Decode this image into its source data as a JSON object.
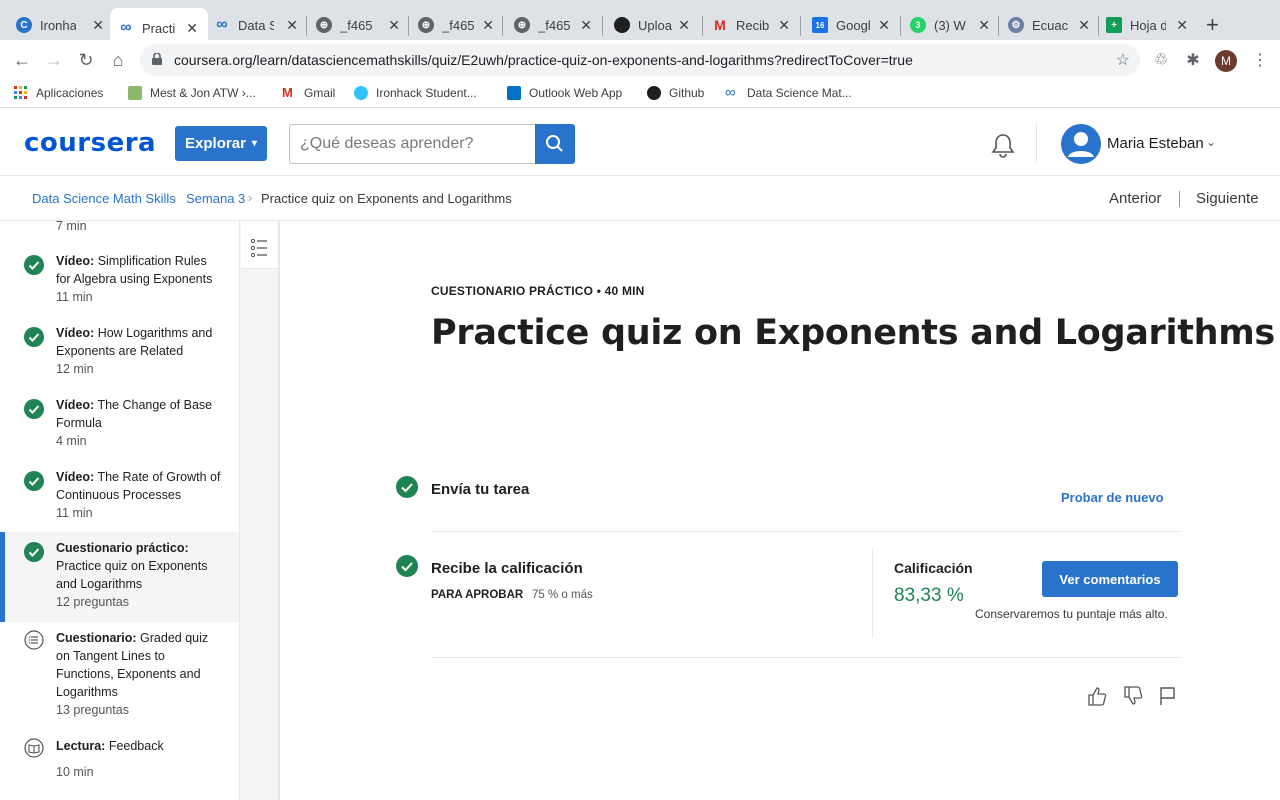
{
  "browser": {
    "tabs": [
      {
        "title": "Ironha",
        "color": "#2a73cc",
        "glyph": "C"
      },
      {
        "title": "Practi",
        "color": "#2a73cc",
        "glyph": "∞",
        "active": true
      },
      {
        "title": "Data S",
        "color": "#2a73cc",
        "glyph": "∞"
      },
      {
        "title": "_f465",
        "color": "#5f6368",
        "glyph": "⊕"
      },
      {
        "title": "_f465",
        "color": "#5f6368",
        "glyph": "⊕"
      },
      {
        "title": "_f465",
        "color": "#5f6368",
        "glyph": "⊕"
      },
      {
        "title": "Uploa",
        "color": "#1f1f1f",
        "glyph": "●"
      },
      {
        "title": "Recib",
        "color": "#d93025",
        "glyph": "M"
      },
      {
        "title": "Googl",
        "color": "#1a73e8",
        "glyph": "16"
      },
      {
        "title": "(3) W",
        "color": "#25d366",
        "glyph": "3"
      },
      {
        "title": "Ecuac",
        "color": "#6a7fa3",
        "glyph": "⚙"
      },
      {
        "title": "Hoja d",
        "color": "#0f9d58",
        "glyph": "+"
      }
    ],
    "url": "coursera.org/learn/datasciencemathskills/quiz/E2uwh/practice-quiz-on-exponents-and-logarithms?redirectToCover=true",
    "profile_initial": "M",
    "bookmarks": [
      {
        "label": "Aplicaciones",
        "icon": "apps-grid-icon"
      },
      {
        "label": "Mest & Jon ATW ›...",
        "icon": "map-icon"
      },
      {
        "label": "Gmail",
        "icon": "gmail-icon"
      },
      {
        "label": "Ironhack Student...",
        "icon": "ironhack-icon"
      },
      {
        "label": "Outlook Web App",
        "icon": "outlook-icon"
      },
      {
        "label": "Github",
        "icon": "github-icon"
      },
      {
        "label": "Data Science Mat...",
        "icon": "coursera-icon"
      }
    ]
  },
  "header": {
    "logo": "coursera",
    "explore_label": "Explorar",
    "search_placeholder": "¿Qué deseas aprender?",
    "user_name": "Maria Esteban"
  },
  "breadcrumb": {
    "items": [
      "Data Science Math Skills",
      "Semana 3",
      "Practice quiz on Exponents and Logarithms"
    ],
    "prev_label": "Anterior",
    "next_label": "Siguiente"
  },
  "sidebar": {
    "items": [
      {
        "kind": "",
        "title": "",
        "meta": "7 min",
        "status": "partial"
      },
      {
        "kind": "Vídeo:",
        "title": "Simplification Rules for Algebra using Exponents",
        "meta": "11 min",
        "status": "done"
      },
      {
        "kind": "Vídeo:",
        "title": "How Logarithms and Exponents are Related",
        "meta": "12 min",
        "status": "done"
      },
      {
        "kind": "Vídeo:",
        "title": "The Change of Base Formula",
        "meta": "4 min",
        "status": "done"
      },
      {
        "kind": "Vídeo:",
        "title": "The Rate of Growth of Continuous Processes",
        "meta": "11 min",
        "status": "done"
      },
      {
        "kind": "Cuestionario práctico:",
        "title": "Practice quiz on Exponents and Logarithms",
        "meta": "12 preguntas",
        "status": "done",
        "active": true
      },
      {
        "kind": "Cuestionario:",
        "title": "Graded quiz on Tangent Lines to Functions, Exponents and Logarithms",
        "meta": "13 preguntas",
        "status": "quiz"
      },
      {
        "kind": "Lectura:",
        "title": "Feedback",
        "meta": "10 min",
        "status": "reading"
      }
    ]
  },
  "main": {
    "eyebrow": "CUESTIONARIO PRÁCTICO • 40 MIN",
    "title": "Practice quiz on Exponents and Logarithms",
    "submit_step": "Envía tu tarea",
    "retry_label": "Probar de nuevo",
    "grade_step": "Recibe la calificación",
    "pass_label": "PARA APROBAR",
    "pass_value": "75 % o más",
    "grade_label": "Calificación",
    "grade_value": "83,33 %",
    "feedback_button": "Ver comentarios",
    "keep_note": "Conservaremos tu puntaje más alto."
  },
  "colors": {
    "brand": "#0056d2",
    "accent": "#2a73cc",
    "success": "#1f8354"
  }
}
